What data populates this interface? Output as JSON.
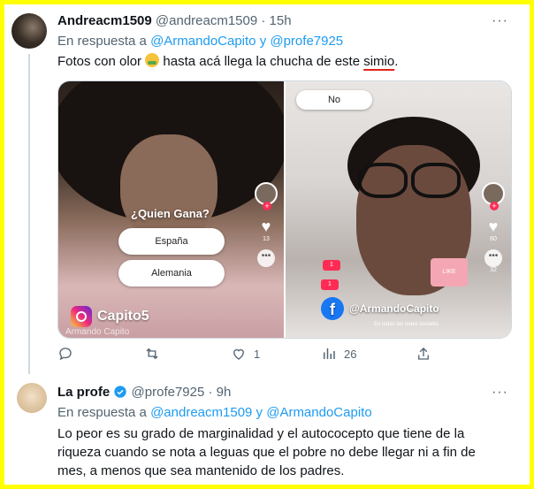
{
  "tweet1": {
    "display_name": "Andreacm1509",
    "handle": "@andreacm1509",
    "time": "· 15h",
    "reply_prefix": "En respuesta a",
    "reply_users": "@ArmandoCapito y @profe7925",
    "text_before": "Fotos con olor",
    "emoji": "nauseated-face-emoji",
    "text_after": "hasta acá llega la chucha de este",
    "text_underlined": "simio",
    "text_end": ".",
    "more_label": "···",
    "media": {
      "left": {
        "question": "¿Quien Gana?",
        "options": [
          "España",
          "Alemania"
        ],
        "likes": "13",
        "account": "Capito5",
        "watermark": "Armando Capito"
      },
      "right": {
        "top_option": "No",
        "likes": "60",
        "comments": "32",
        "account": "@ArmandoCapito",
        "subtitle": "En todas las redes sociales",
        "like_box": "LIKE",
        "bubble1": "1",
        "bubble2": "1"
      }
    },
    "actions": {
      "replies": "",
      "retweets": "",
      "likes": "1",
      "views": "26"
    }
  },
  "tweet2": {
    "display_name": "La profe",
    "handle": "@profe7925",
    "time": "· 9h",
    "reply_prefix": "En respuesta a",
    "reply_users": "@andreacm1509 y @ArmandoCapito",
    "text_lines": [
      "Lo peor es su grado de marginalidad y el autococepto que tiene de la",
      "riqueza cuando se nota a leguas que el pobre no debe llegar ni a fin de",
      "mes, a menos que sea mantenido de los padres."
    ],
    "more_label": "···"
  },
  "colors": {
    "frame_border": "#ffff00",
    "link": "#1d9bf0",
    "secondary_text": "#536471",
    "primary_text": "#0f1419",
    "underline": "#e0241b",
    "verified": "#1d9bf0"
  }
}
